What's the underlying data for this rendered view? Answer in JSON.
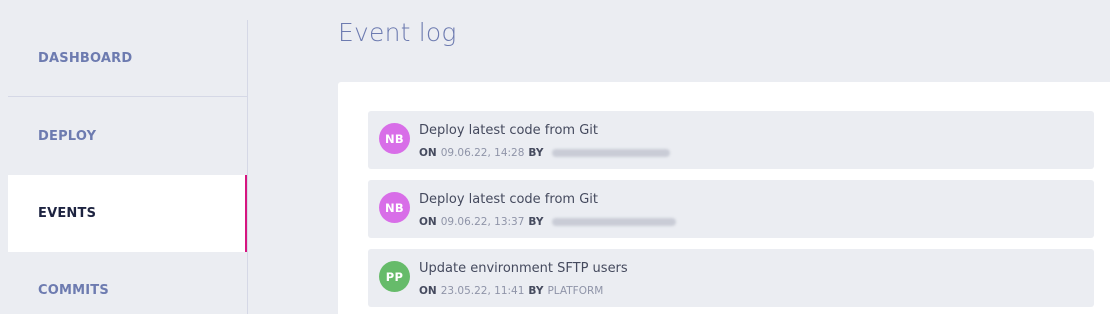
{
  "sidebar": {
    "items": [
      {
        "label": "DASHBOARD",
        "active": false
      },
      {
        "label": "DEPLOY",
        "active": false
      },
      {
        "label": "EVENTS",
        "active": true
      },
      {
        "label": "COMMITS",
        "active": false
      }
    ],
    "accent_color": "#d6157f"
  },
  "main": {
    "title": "Event log",
    "events": [
      {
        "avatar_initials": "NB",
        "avatar_color": "#d86ee8",
        "title": "Deploy latest code from Git",
        "on_label": "ON",
        "datetime": "09.06.22, 14:28",
        "by_label": "BY",
        "author": ""
      },
      {
        "avatar_initials": "NB",
        "avatar_color": "#d86ee8",
        "title": "Deploy latest code from Git",
        "on_label": "ON",
        "datetime": "09.06.22, 13:37",
        "by_label": "BY",
        "author": ""
      },
      {
        "avatar_initials": "PP",
        "avatar_color": "#66bb6a",
        "title": "Update environment SFTP users",
        "on_label": "ON",
        "datetime": "23.05.22, 11:41",
        "by_label": "BY",
        "author": "PLATFORM"
      }
    ]
  }
}
